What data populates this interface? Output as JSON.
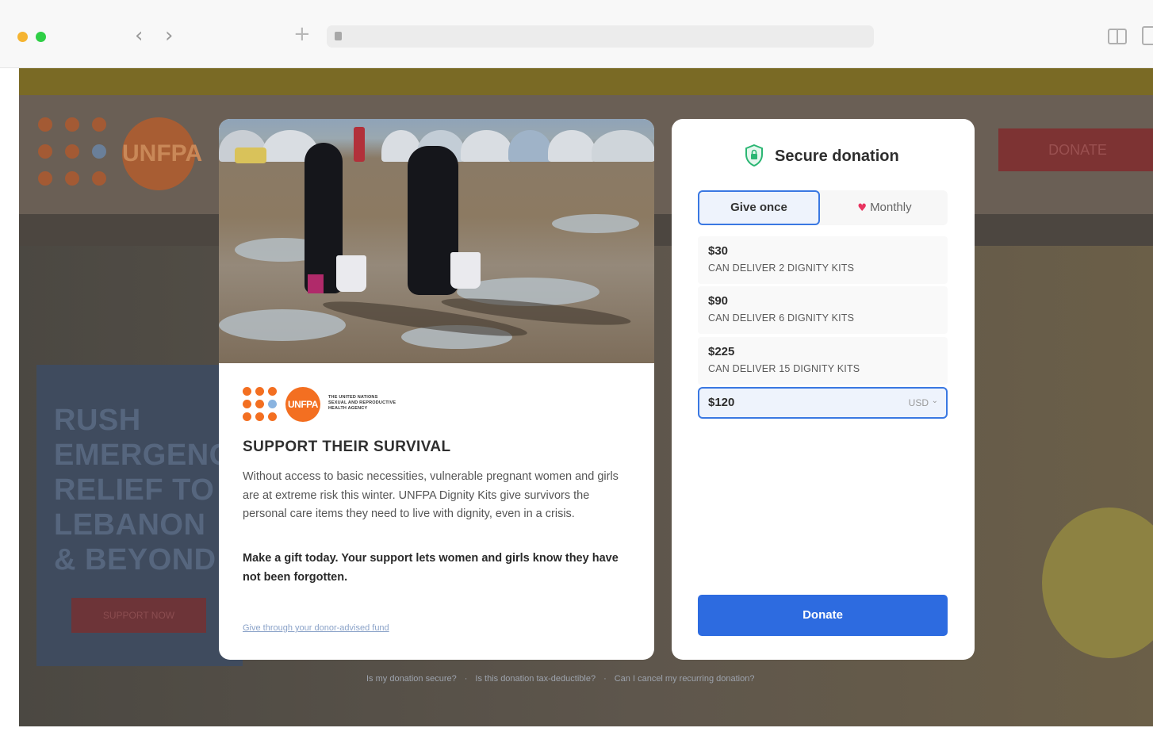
{
  "browser": {
    "nav_back_glyph": "‹",
    "nav_forward_glyph": "›",
    "new_tab_glyph": "+",
    "traffic_light_colors": [
      "#f5b431",
      "#2fcf46"
    ]
  },
  "background_site": {
    "banner_text": "",
    "logo_text": "UNFPA",
    "header_donate_label": "DONATE",
    "hero_title": "RUSH EMERGENCY RELIEF TO LEBANON & BEYOND",
    "hero_button_label": "SUPPORT NOW"
  },
  "left_card": {
    "brand": {
      "logo_text": "UNFPA",
      "tagline_lines": [
        "THE UNITED NATIONS",
        "SEXUAL AND REPRODUCTIVE",
        "HEALTH AGENCY"
      ]
    },
    "headline": "SUPPORT THEIR SURVIVAL",
    "body": "Without access to basic necessities, vulnerable pregnant women and girls are at extreme risk this winter. UNFPA Dignity Kits give survivors the personal care items they need to live with dignity, even in a crisis.",
    "body_bold": "Make a gift today. Your support lets women and girls know they have not been forgotten.",
    "daf_link": "Give through your donor-advised fund"
  },
  "right_card": {
    "title": "Secure donation",
    "frequency": {
      "once_label": "Give once",
      "monthly_label": "Monthly",
      "selected": "once"
    },
    "amounts": [
      {
        "value": "$30",
        "description": "CAN DELIVER 2 DIGNITY KITS"
      },
      {
        "value": "$90",
        "description": "CAN DELIVER 6 DIGNITY KITS"
      },
      {
        "value": "$225",
        "description": "CAN DELIVER 15 DIGNITY KITS"
      }
    ],
    "custom_amount": {
      "value": "$120",
      "currency": "USD"
    },
    "donate_label": "Donate",
    "accent_color": "#2d6be0"
  },
  "faq": {
    "items": [
      "Is my donation secure?",
      "Is this donation tax-deductible?",
      "Can I cancel my recurring donation?"
    ]
  }
}
